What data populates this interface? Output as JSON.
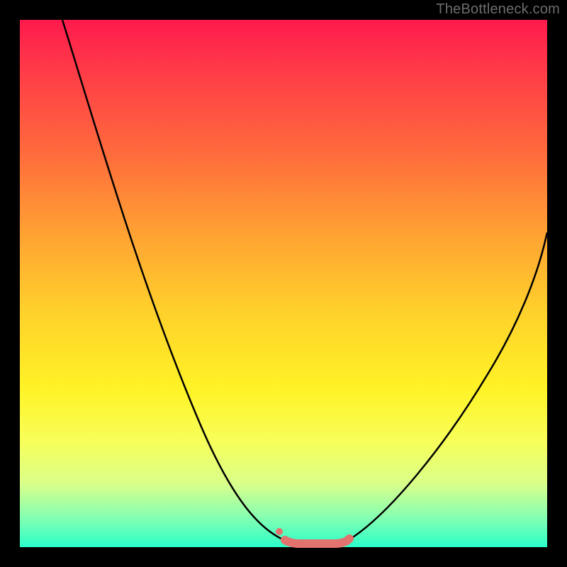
{
  "watermark": "TheBottleneck.com",
  "colors": {
    "bg_black": "#000000",
    "curve_black": "#000000",
    "accent_pink": "#e2736f",
    "text_gray": "#6d6d6d"
  },
  "chart_data": {
    "type": "line",
    "title": "",
    "xlabel": "",
    "ylabel": "",
    "xlim": [
      0,
      100
    ],
    "ylim": [
      0,
      100
    ],
    "grid": false,
    "series": [
      {
        "name": "left-curve",
        "x": [
          8,
          15,
          20,
          25,
          30,
          35,
          40,
          45,
          50
        ],
        "values": [
          100,
          85,
          72,
          59,
          46,
          33,
          20,
          9,
          1
        ]
      },
      {
        "name": "right-curve",
        "x": [
          62,
          68,
          74,
          80,
          86,
          92,
          100
        ],
        "values": [
          1,
          8,
          17,
          27,
          37,
          47,
          60
        ]
      },
      {
        "name": "bottom-segment",
        "x": [
          50,
          53,
          56,
          59,
          62
        ],
        "values": [
          1,
          0.5,
          0.5,
          0.5,
          1
        ]
      }
    ],
    "markers": [
      {
        "name": "small-dot",
        "x": 49,
        "y": 3,
        "size": 8,
        "color": "#e2736f"
      },
      {
        "name": "left-cap",
        "x": 50.2,
        "y": 1.5,
        "size": 14,
        "color": "#e2736f"
      },
      {
        "name": "right-cap",
        "x": 62,
        "y": 1.5,
        "size": 14,
        "color": "#e2736f"
      }
    ],
    "annotations": []
  }
}
